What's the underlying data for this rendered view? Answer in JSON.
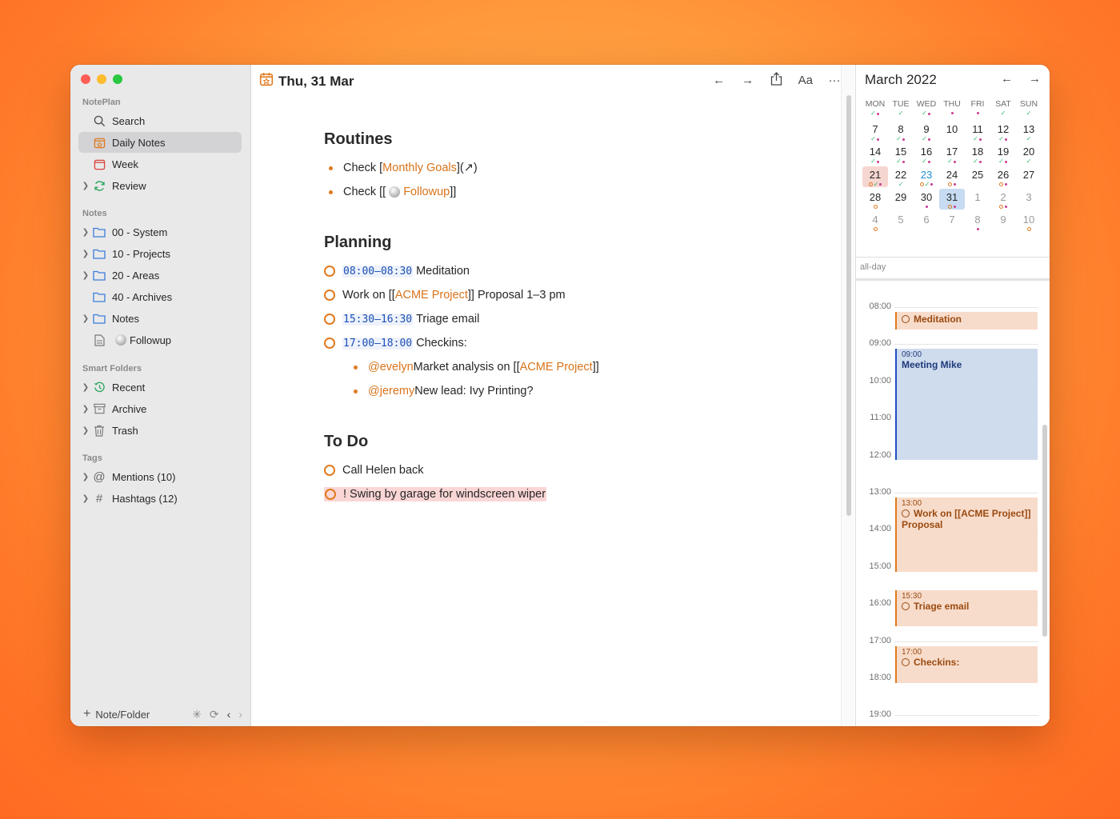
{
  "sidebar": {
    "app_section": "NotePlan",
    "top_items": [
      {
        "label": "Search"
      },
      {
        "label": "Daily Notes"
      },
      {
        "label": "Week"
      },
      {
        "label": "Review"
      }
    ],
    "notes_section": "Notes",
    "folders": [
      {
        "label": "00 - System"
      },
      {
        "label": "10 - Projects"
      },
      {
        "label": "20 - Areas"
      },
      {
        "label": "40 - Archives"
      },
      {
        "label": "Notes"
      },
      {
        "label": "Followup"
      }
    ],
    "smart_section": "Smart Folders",
    "smart_items": [
      {
        "label": "Recent"
      },
      {
        "label": "Archive"
      },
      {
        "label": "Trash"
      }
    ],
    "tags_section": "Tags",
    "tag_items": [
      {
        "label": "Mentions (10)"
      },
      {
        "label": "Hashtags (12)"
      }
    ],
    "footer_add": "Note/Folder"
  },
  "editor": {
    "date_title": "Thu, 31 Mar",
    "toolbar": {
      "font_label": "Aa",
      "more": "···"
    },
    "routines_heading": "Routines",
    "routine1": {
      "pre": "Check [",
      "link": "Monthly Goals",
      "post": "](↗)"
    },
    "routine2": {
      "pre": "Check [[",
      "link": "Followup",
      "post": "]]"
    },
    "planning_heading": "Planning",
    "plan1": {
      "time": "08:00–08:30",
      "text": "Meditation"
    },
    "plan2": {
      "pre": "Work on [[",
      "link": "ACME Project",
      "post": "]] Proposal 1–3 pm"
    },
    "plan3": {
      "time": "15:30–16:30",
      "text": "Triage email"
    },
    "plan4": {
      "time": "17:00–18:00",
      "text": "Checkins:"
    },
    "sub1": {
      "mention": "@evelyn",
      "pre": " Market analysis on [[",
      "link": "ACME Project",
      "post": "]]"
    },
    "sub2": {
      "mention": "@jeremy",
      "text": " New lead: Ivy Printing?"
    },
    "todo_heading": "To Do",
    "todo1": "Call Helen back",
    "todo2": "! Swing by garage for windscreen wiper"
  },
  "calendar": {
    "month_title": "March 2022",
    "weekdays": [
      "MON",
      "TUE",
      "WED",
      "THU",
      "FRI",
      "SAT",
      "SUN"
    ],
    "weeks": [
      [
        "",
        "",
        "",
        "",
        "",
        "",
        ""
      ],
      [
        "7",
        "8",
        "9",
        "10",
        "11",
        "12",
        "13"
      ],
      [
        "14",
        "15",
        "16",
        "17",
        "18",
        "19",
        "20"
      ],
      [
        "21",
        "22",
        "23",
        "24",
        "25",
        "26",
        "27"
      ],
      [
        "28",
        "29",
        "30",
        "31",
        "1",
        "2",
        "3"
      ],
      [
        "4",
        "5",
        "6",
        "7",
        "8",
        "9",
        "10"
      ]
    ],
    "allday_label": "all-day",
    "hours": [
      "08:00",
      "09:00",
      "10:00",
      "11:00",
      "12:00",
      "13:00",
      "14:00",
      "15:00",
      "16:00",
      "17:00",
      "18:00",
      "19:00"
    ],
    "events": [
      {
        "title": "Meditation",
        "time": ""
      },
      {
        "title": "Meeting Mike",
        "time": "09:00"
      },
      {
        "title": "Work on [[ACME Project]] Proposal",
        "time": "13:00"
      },
      {
        "title": "Triage email",
        "time": "15:30"
      },
      {
        "title": "Checkins:",
        "time": "17:00"
      }
    ]
  },
  "colors": {
    "accent": "#e07a1f",
    "time_blue": "#1a4fb8",
    "selected_day": "#c7dcf3",
    "today_day": "#f6d6d1"
  }
}
